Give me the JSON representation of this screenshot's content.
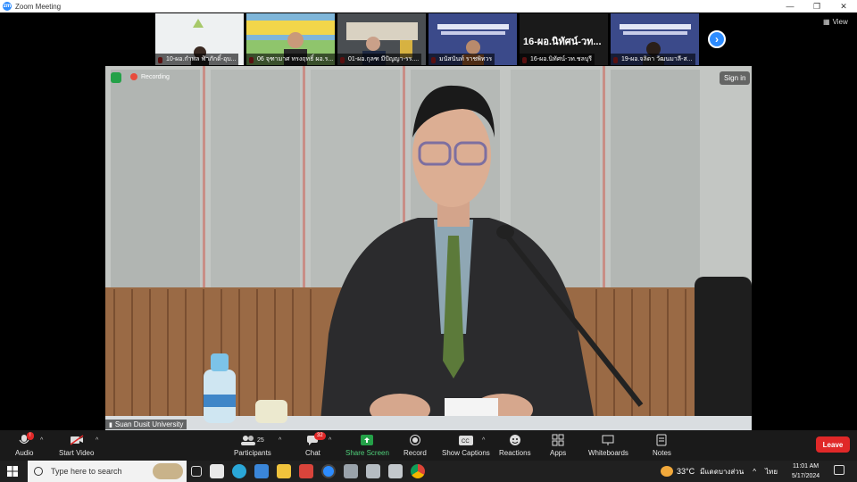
{
  "window": {
    "title": "Zoom Meeting"
  },
  "gallery": {
    "participants": [
      {
        "name": "10-ผอ.กำพล ฟ้าภักดิ์-อุบ..."
      },
      {
        "name": "06 จุฑามาศ ทรงฤทธิ์ ผอ.ร..."
      },
      {
        "name": "01-ผอ.กุลฑ มีปัญญา-รร...."
      },
      {
        "name": "มนัสนันท์ ราชพิทวร"
      },
      {
        "name": "16-ผอ.นิทัศน์-วท.ชลบุรี",
        "display_text": "16-ผอ.นิทัศน์-วท..."
      },
      {
        "name": "19-ผอ.จลิดา วัฒนมาลี-ส..."
      }
    ],
    "view_label": "View"
  },
  "main": {
    "recording_label": "Recording",
    "signin_label": "Sign in",
    "speaker_name": "Suan Dusit University"
  },
  "toolbar": {
    "audio_label": "Audio",
    "start_video_label": "Start Video",
    "participants_label": "Participants",
    "participants_count": "25",
    "chat_label": "Chat",
    "chat_badge": "32",
    "share_label": "Share Screen",
    "record_label": "Record",
    "captions_label": "Show Captions",
    "reactions_label": "Reactions",
    "apps_label": "Apps",
    "whiteboards_label": "Whiteboards",
    "notes_label": "Notes",
    "leave_label": "Leave"
  },
  "taskbar": {
    "search_placeholder": "Type here to search",
    "weather": "33°C",
    "weather_desc": "มีแดดบางส่วน",
    "language": "ไทย",
    "time": "11:01 AM",
    "date": "5/17/2024"
  },
  "colors": {
    "zoom_blue": "#2d8cff",
    "leave_red": "#e02828",
    "share_green": "#24a148"
  }
}
